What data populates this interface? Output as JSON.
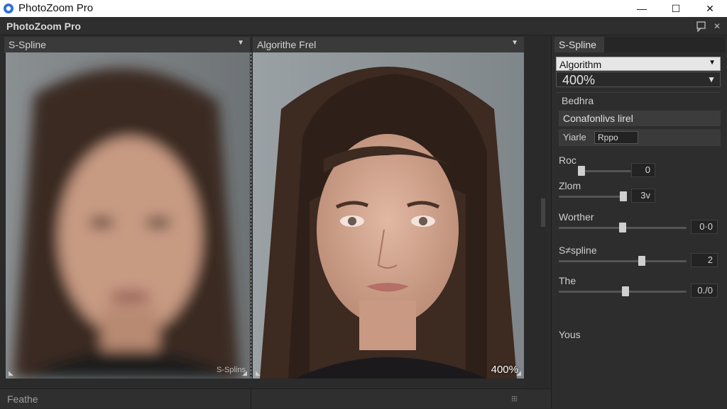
{
  "window": {
    "title": "PhotoZoom Pro",
    "minimize_glyph": "—",
    "maximize_glyph": "☐",
    "close_glyph": "✕"
  },
  "appbar": {
    "name": "PhotoZoom Pro",
    "icons": [
      "pin-icon",
      "close-icon"
    ]
  },
  "left_pane": {
    "header": "S-Spline",
    "overlay_label": "S-Splins"
  },
  "right_pane": {
    "header": "Algorithe Frel",
    "zoom_label": "400%"
  },
  "bottom": {
    "label": "Feathe"
  },
  "sidebar": {
    "tab": "S-Spline",
    "algorithm_select": "Algorithm",
    "zoom_select": "400%",
    "section_label": "Bedhra",
    "preset_field": "Conafonlivs lirel",
    "yiarle_label": "Yiarle",
    "yiarle_value": "Rppo",
    "sliders": [
      {
        "label": "Roc",
        "value": "0",
        "level": 0.0
      },
      {
        "label": "Zlom",
        "value": "3v",
        "level": 0.95
      },
      {
        "label": "Worther",
        "value": "0·0",
        "level": 0.5
      },
      {
        "label": "S≠spline",
        "value": "2",
        "level": 0.65
      },
      {
        "label": "The",
        "value": "0./0",
        "level": 0.52
      }
    ],
    "footer_label": "Yous"
  },
  "colors": {
    "panel_bg": "#2d2d2d",
    "header_bg": "#3a3a3a",
    "input_light": "#e6e6e6"
  }
}
